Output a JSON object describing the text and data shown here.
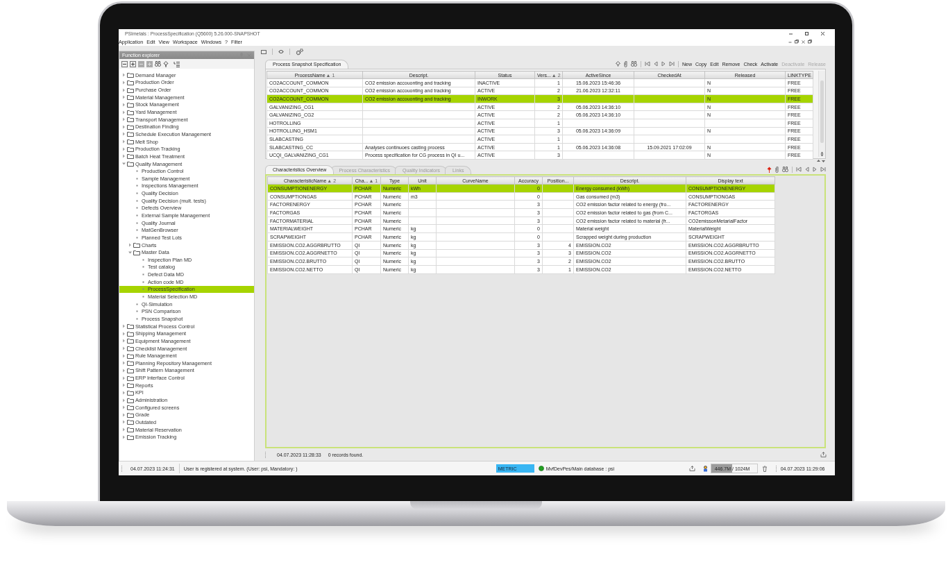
{
  "window": {
    "title": "PSImetals : ProcessSpecification (Q5600) 5.26.000-SNAPSHOT",
    "menu": [
      "Application",
      "Edit",
      "View",
      "Workspace",
      "Windows",
      "?",
      "Filter"
    ]
  },
  "function_explorer": {
    "title": "Function explorer",
    "tree": [
      {
        "label": "Demand Manager",
        "kind": "folder",
        "expanded": false,
        "selected": false
      },
      {
        "label": "Production Order",
        "kind": "folder",
        "expanded": false,
        "selected": false
      },
      {
        "label": "Purchase Order",
        "kind": "folder",
        "expanded": false,
        "selected": false
      },
      {
        "label": "Material Management",
        "kind": "folder",
        "expanded": false,
        "selected": false
      },
      {
        "label": "Stock Management",
        "kind": "folder",
        "expanded": false,
        "selected": false
      },
      {
        "label": "Yard Management",
        "kind": "folder",
        "expanded": false,
        "selected": false
      },
      {
        "label": "Transport Management",
        "kind": "folder",
        "expanded": false,
        "selected": false
      },
      {
        "label": "Destination Finding",
        "kind": "folder",
        "expanded": false,
        "selected": false
      },
      {
        "label": "Schedule Execution Management",
        "kind": "folder",
        "expanded": false,
        "selected": false
      },
      {
        "label": "Melt Shop",
        "kind": "folder",
        "expanded": false,
        "selected": false
      },
      {
        "label": "Production Tracking",
        "kind": "folder",
        "expanded": false,
        "selected": false
      },
      {
        "label": "Batch Heat Treatment",
        "kind": "folder",
        "expanded": false,
        "selected": false
      },
      {
        "label": "Quality Management",
        "kind": "folder",
        "expanded": true,
        "selected": false,
        "children": [
          {
            "label": "Production Control",
            "kind": "leaf",
            "selected": false
          },
          {
            "label": "Sample Management",
            "kind": "leaf",
            "selected": false
          },
          {
            "label": "Inspections Management",
            "kind": "leaf",
            "selected": false
          },
          {
            "label": "Quality Decision",
            "kind": "leaf",
            "selected": false
          },
          {
            "label": "Quality Decision (mult. tests)",
            "kind": "leaf",
            "selected": false
          },
          {
            "label": "Defects Overview",
            "kind": "leaf",
            "selected": false
          },
          {
            "label": "External Sample Management",
            "kind": "leaf",
            "selected": false
          },
          {
            "label": "Quality Journal",
            "kind": "leaf",
            "selected": false
          },
          {
            "label": "MatGenBrowser",
            "kind": "leaf",
            "selected": false
          },
          {
            "label": "Planned Test Lots",
            "kind": "leaf",
            "selected": false
          },
          {
            "label": "Charts",
            "kind": "folder",
            "expanded": false,
            "selected": false
          },
          {
            "label": "Master Data",
            "kind": "folder",
            "expanded": true,
            "selected": false,
            "children": [
              {
                "label": "Inspection Plan MD",
                "kind": "leaf",
                "selected": false
              },
              {
                "label": "Test catalog",
                "kind": "leaf",
                "selected": false
              },
              {
                "label": "Defect Data MD",
                "kind": "leaf",
                "selected": false
              },
              {
                "label": "Action code MD",
                "kind": "leaf",
                "selected": false
              },
              {
                "label": "ProcessSpecification",
                "kind": "leaf",
                "selected": true
              },
              {
                "label": "Material Selection MD",
                "kind": "leaf",
                "selected": false
              }
            ]
          },
          {
            "label": "QI-Simulation",
            "kind": "leaf",
            "selected": false
          },
          {
            "label": "PSN Comparison",
            "kind": "leaf",
            "selected": false
          },
          {
            "label": "Process Snapshot",
            "kind": "leaf",
            "selected": false
          }
        ]
      },
      {
        "label": "Statistical Process Control",
        "kind": "folder",
        "expanded": false,
        "selected": false
      },
      {
        "label": "Shipping Management",
        "kind": "folder",
        "expanded": false,
        "selected": false
      },
      {
        "label": "Equipment Management",
        "kind": "folder",
        "expanded": false,
        "selected": false
      },
      {
        "label": "Checklist Management",
        "kind": "folder",
        "expanded": false,
        "selected": false
      },
      {
        "label": "Rule Management",
        "kind": "folder",
        "expanded": false,
        "selected": false
      },
      {
        "label": "Planning Repository Management",
        "kind": "folder",
        "expanded": false,
        "selected": false
      },
      {
        "label": "Shift Pattern Management",
        "kind": "folder",
        "expanded": false,
        "selected": false
      },
      {
        "label": "ERP Interface Control",
        "kind": "folder",
        "expanded": false,
        "selected": false
      },
      {
        "label": "Reports",
        "kind": "folder",
        "expanded": false,
        "selected": false
      },
      {
        "label": "KPI",
        "kind": "folder",
        "expanded": false,
        "selected": false
      },
      {
        "label": "Administration",
        "kind": "folder",
        "expanded": false,
        "selected": false
      },
      {
        "label": "Configured screens",
        "kind": "folder",
        "expanded": false,
        "selected": false
      },
      {
        "label": "Grade",
        "kind": "folder",
        "expanded": false,
        "selected": false
      },
      {
        "label": "Outdated",
        "kind": "folder",
        "expanded": false,
        "selected": false
      },
      {
        "label": "Material Reservation",
        "kind": "folder",
        "expanded": false,
        "selected": false
      },
      {
        "label": "Emission Tracking",
        "kind": "folder",
        "expanded": false,
        "selected": false
      }
    ]
  },
  "process_tabs": [
    {
      "label": "Process Snapshot Specification",
      "selected": true
    }
  ],
  "actions": [
    {
      "label": "New",
      "disabled": false
    },
    {
      "label": "Copy",
      "disabled": false
    },
    {
      "label": "Edit",
      "disabled": false
    },
    {
      "label": "Remove",
      "disabled": false
    },
    {
      "label": "Check",
      "disabled": false
    },
    {
      "label": "Activate",
      "disabled": false
    },
    {
      "label": "Deactivate",
      "disabled": true
    },
    {
      "label": "Release",
      "disabled": true
    }
  ],
  "process_table": {
    "columns": [
      {
        "label": "ProcessName",
        "sort": "▲ 1",
        "kind": "text"
      },
      {
        "label": "Descript.",
        "kind": "text"
      },
      {
        "label": "Status",
        "kind": "text"
      },
      {
        "label": "Vers...",
        "sort": "▲ 2",
        "kind": "number"
      },
      {
        "label": "ActiveSince",
        "kind": "date"
      },
      {
        "label": "CheckedAt",
        "kind": "date"
      },
      {
        "label": "Released",
        "kind": "text"
      },
      {
        "label": "LINKTYPE",
        "kind": "text"
      }
    ],
    "rows": [
      {
        "selected": false,
        "cells": [
          "CO2ACCOUNT_COMMON",
          "CO2 emission accouonting and tracking",
          "INACTIVE",
          "1",
          "15.06.2023 15:46:36",
          null,
          "N",
          "FREE"
        ]
      },
      {
        "selected": false,
        "cells": [
          "CO2ACCOUNT_COMMON",
          "CO2 emission accouonting and tracking",
          "ACTIVE",
          "2",
          "21.06.2023 12:32:11",
          null,
          "N",
          "FREE"
        ]
      },
      {
        "selected": true,
        "cells": [
          "CO2ACCOUNT_COMMON",
          "CO2 emission accouonting and tracking",
          "INWORK",
          "3",
          null,
          null,
          "N",
          "FREE"
        ]
      },
      {
        "selected": false,
        "cells": [
          "GALVANIZING_CG1",
          null,
          "ACTIVE",
          "2",
          "05.06.2023 14:36:10",
          null,
          "N",
          "FREE"
        ]
      },
      {
        "selected": false,
        "cells": [
          "GALVANIZING_CG2",
          null,
          "ACTIVE",
          "2",
          "05.06.2023 14:36:10",
          null,
          "N",
          "FREE"
        ]
      },
      {
        "selected": false,
        "cells": [
          "HOTROLLING",
          null,
          "ACTIVE",
          "1",
          null,
          null,
          null,
          "FREE"
        ]
      },
      {
        "selected": false,
        "cells": [
          "HOTROLLING_HSM1",
          null,
          "ACTIVE",
          "3",
          "05.06.2023 14:36:09",
          null,
          "N",
          "FREE"
        ]
      },
      {
        "selected": false,
        "cells": [
          "SLABCASTING",
          null,
          "ACTIVE",
          "1",
          null,
          null,
          null,
          "FREE"
        ]
      },
      {
        "selected": false,
        "cells": [
          "SLABCASTING_CC",
          "Analyses continuoes casting process",
          "ACTIVE",
          "1",
          "05.06.2023 14:36:08",
          "15.09.2021 17:02:09",
          "N",
          "FREE"
        ]
      },
      {
        "selected": false,
        "cells": [
          "UCQI_GALVANIZING_CG1",
          "Process specification for CG process in QI u...",
          "ACTIVE",
          "3",
          null,
          null,
          "N",
          "FREE"
        ]
      }
    ]
  },
  "detail_tabs": [
    {
      "label": "Characteristics Overview",
      "selected": true
    },
    {
      "label": "Process Characteristics",
      "selected": false
    },
    {
      "label": "Quality Indicators",
      "selected": false
    },
    {
      "label": "Links",
      "selected": false
    }
  ],
  "characteristics_table": {
    "columns": [
      {
        "label": "CharacteristicName",
        "sort": "▲ 2",
        "kind": "text"
      },
      {
        "label": "Cha...",
        "sort": "▲ 1",
        "kind": "text"
      },
      {
        "label": "Type",
        "kind": "text"
      },
      {
        "label": "Unit",
        "kind": "text"
      },
      {
        "label": "CurveName",
        "kind": "text"
      },
      {
        "label": "Accuracy",
        "kind": "number"
      },
      {
        "label": "Position...",
        "kind": "number"
      },
      {
        "label": "Descript.",
        "kind": "text"
      },
      {
        "label": "Display text",
        "kind": "text"
      }
    ],
    "rows": [
      {
        "selected": true,
        "cells": [
          "CONSUMPTIONENERGY",
          "PCHAR",
          "Numeric",
          "kWh",
          null,
          "0",
          null,
          "Energy consumed (kWh)",
          "CONSUMPTIONENERGY"
        ]
      },
      {
        "selected": false,
        "cells": [
          "CONSUMPTIONGAS",
          "PCHAR",
          "Numeric",
          "m3",
          null,
          "0",
          null,
          "Gas consumed (m3)",
          "CONSUMPTIONGAS"
        ]
      },
      {
        "selected": false,
        "cells": [
          "FACTORENERGY",
          "PCHAR",
          "Numeric",
          null,
          null,
          "3",
          null,
          "CO2 emission factor related to energy (fro...",
          "FACTORENERGY"
        ]
      },
      {
        "selected": false,
        "cells": [
          "FACTORGAS",
          "PCHAR",
          "Numeric",
          null,
          null,
          "3",
          null,
          "CO2 emission factor related to gas (from C...",
          "FACTORGAS"
        ]
      },
      {
        "selected": false,
        "cells": [
          "FACTORMATERIAL",
          "PCHAR",
          "Numeric",
          null,
          null,
          "3",
          null,
          "CO2 emission factor related to material (fr...",
          "CO2emissonMetarialFactor"
        ]
      },
      {
        "selected": false,
        "cells": [
          "MATERIALWEIGHT",
          "PCHAR",
          "Numeric",
          "kg",
          null,
          "0",
          null,
          "Material weight",
          "MaterialWeight"
        ]
      },
      {
        "selected": false,
        "cells": [
          "SCRAPWEIGHT",
          "PCHAR",
          "Numeric",
          "kg",
          null,
          "0",
          null,
          "Scrapped weight during production",
          "SCRAPWEIGHT"
        ]
      },
      {
        "selected": false,
        "cells": [
          "EMISSION.CO2.AGGRBRUTTO",
          "QI",
          "Numeric",
          "kg",
          null,
          "3",
          "4",
          "EMISSION.CO2",
          "EMISSION.CO2.AGGRBRUTTO"
        ]
      },
      {
        "selected": false,
        "cells": [
          "EMISSION.CO2.AGGRNETTO",
          "QI",
          "Numeric",
          "kg",
          null,
          "3",
          "3",
          "EMISSION.CO2",
          "EMISSION.CO2.AGGRNETTO"
        ]
      },
      {
        "selected": false,
        "cells": [
          "EMISSION.CO2.BRUTTO",
          "QI",
          "Numeric",
          "kg",
          null,
          "3",
          "2",
          "EMISSION.CO2",
          "EMISSION.CO2.BRUTTO"
        ]
      },
      {
        "selected": false,
        "cells": [
          "EMISSION.CO2.NETTO",
          "QI",
          "Numeric",
          "kg",
          null,
          "3",
          "1",
          "EMISSION.CO2",
          "EMISSION.CO2.NETTO"
        ]
      }
    ]
  },
  "panel_status": {
    "time": "04.07.2023 11:28:33",
    "message": "0 records found."
  },
  "status_bar": {
    "time": "04.07.2023 11:24:31",
    "message": "User is registered at system. (User: psi, Mandatory: )",
    "unit": "METRIC",
    "database": "MvfDevPes/Main database : psi",
    "memory": {
      "text": "446.7M / 1024M",
      "level": 0.46
    },
    "clock": "04.07.2023 11:29:06"
  }
}
